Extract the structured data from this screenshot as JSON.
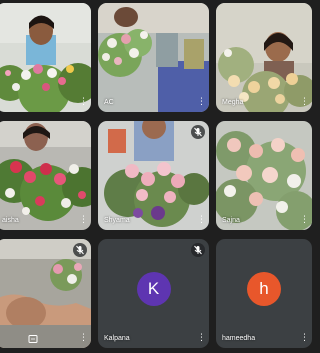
{
  "participants": [
    {
      "name": "",
      "muted": false
    },
    {
      "name": "AC",
      "muted": false
    },
    {
      "name": "Megha",
      "muted": false
    },
    {
      "name": "aisha",
      "muted": false
    },
    {
      "name": "Shyama",
      "muted": true
    },
    {
      "name": "Sajna",
      "muted": false
    },
    {
      "name": "",
      "muted": true
    },
    {
      "name": "Kalpana",
      "muted": true,
      "avatar_letter": "K",
      "avatar_color": "#5e35b1"
    },
    {
      "name": "hameedha",
      "muted": false,
      "avatar_letter": "h",
      "avatar_color": "#e8572b"
    }
  ],
  "tile_background": "#3c4043",
  "page_background": "#1f1f1f"
}
